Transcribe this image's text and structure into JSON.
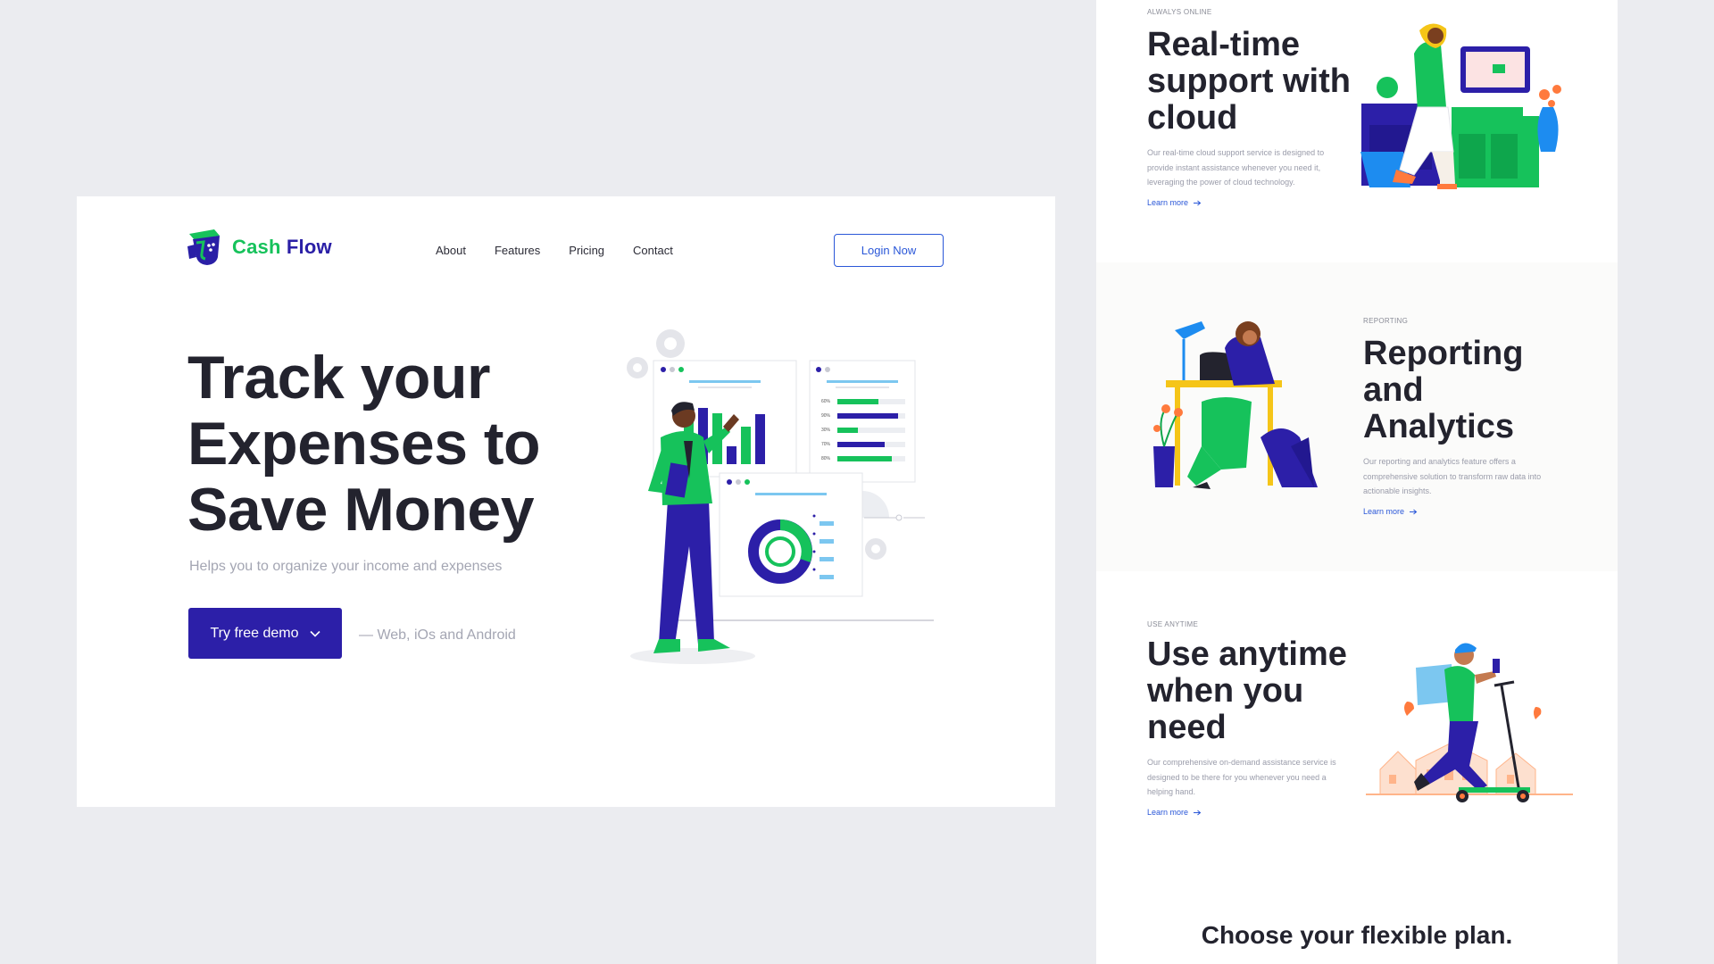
{
  "brand": {
    "name_part1": "Cash",
    "name_part2": "Flow",
    "color_green": "#16c25b",
    "color_navy": "#2a1fa6"
  },
  "nav": {
    "items": [
      "About",
      "Features",
      "Pricing",
      "Contact"
    ],
    "login_label": "Login Now"
  },
  "hero": {
    "title": "Track your Expenses to Save Money",
    "subtitle": "Helps you to organize your income and expenses",
    "cta_label": "Try free demo",
    "platforms": "— Web, iOs and Android"
  },
  "hero_chart_labels": [
    "60%",
    "90%",
    "30%",
    "70%",
    "80%"
  ],
  "features": [
    {
      "eyebrow": "ALWALYS ONLINE",
      "title": "Real-time support with cloud",
      "description": "Our real-time cloud support service is designed to provide instant assistance whenever you need it, leveraging the power of cloud technology.",
      "link": "Learn more"
    },
    {
      "eyebrow": "REPORTING",
      "title": "Reporting and Analytics",
      "description": "Our reporting and analytics feature offers a comprehensive solution to transform raw data into actionable insights.",
      "link": "Learn more"
    },
    {
      "eyebrow": "USE ANYTIME",
      "title": "Use anytime when you need",
      "description": "Our comprehensive on-demand assistance service is designed to be there for you whenever you need a helping hand.",
      "link": "Learn more"
    }
  ],
  "plans": {
    "title": "Choose your flexible plan."
  },
  "colors": {
    "accent": "#2c1fa8",
    "link": "#2a57d8",
    "green": "#16c25b",
    "page_bg": "#ebecf0"
  },
  "icons": [
    "logo-icon",
    "chevron-down-icon",
    "arrow-right-icon",
    "gear-icon"
  ]
}
